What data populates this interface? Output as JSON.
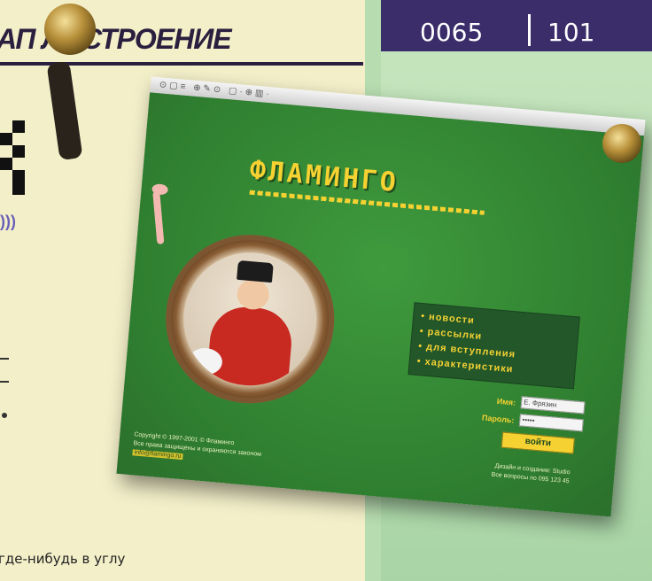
{
  "header": {
    "title": "АП ЛОСТРОЕНИЕ",
    "page_left": "0065",
    "page_right": "101"
  },
  "left_column": {
    "link_marks": ")))",
    "caption": "где-нибудь в углу"
  },
  "website": {
    "toolbar_icons": "⊙▢≡ ⊕✎⊙ ▢·⊕▥·",
    "logo": "ФЛАМИНГО",
    "menu": [
      "новости",
      "рассылки",
      "для вступления",
      "характеристики"
    ],
    "login": {
      "name_label": "Имя:",
      "name_value": "E. Фрязин",
      "password_label": "Пароль:",
      "password_value": "•••••",
      "button_label": "войти"
    },
    "footer_left_line1": "Copyright © 1997-2001 © Фламинго",
    "footer_left_line2": "Все права защищены и охраняются законом",
    "footer_left_link": "info@flamingo.ru",
    "footer_right_line1": "Дизайн и создание: Studio",
    "footer_right_line2": "Все вопросы по 095 123 45"
  },
  "colors": {
    "header_bar": "#3a2d6a",
    "site_green": "#2f7f30",
    "accent_yellow": "#f5d232"
  }
}
